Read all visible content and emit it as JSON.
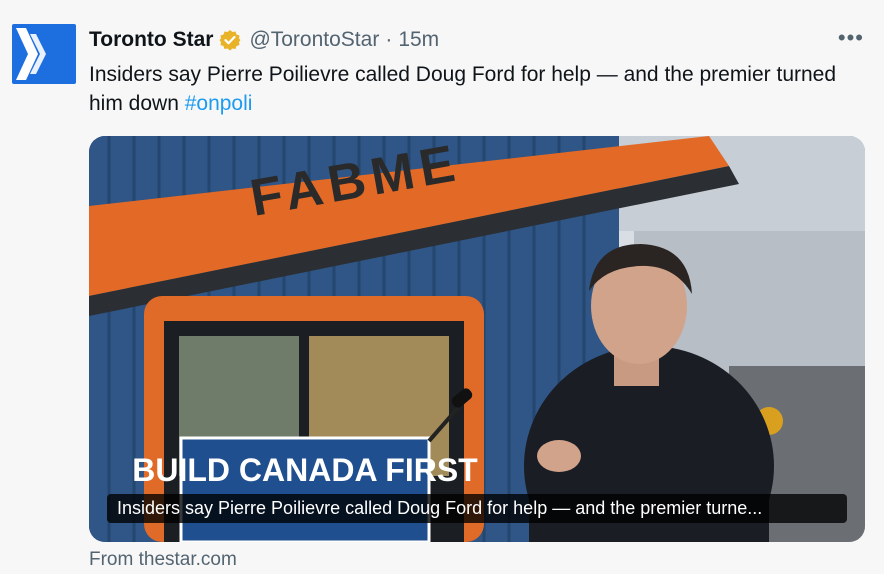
{
  "account": {
    "name": "Toronto Star",
    "handle": "@TorontoStar",
    "separator": "·",
    "time": "15m",
    "verified": true,
    "avatar_icon": "toronto-star-logo-icon",
    "avatar_color": "#1d6fe0"
  },
  "menu": {
    "more_label": "•••"
  },
  "tweet": {
    "text": "Insiders say Pierre Poilievre called Doug Ford for help — and the premier turned him down ",
    "hashtag": "#onpoli"
  },
  "card": {
    "caption": "Insiders say Pierre Poilievre called Doug Ford for help — and the premier turne...",
    "image_text": {
      "crane_brand": "FABME",
      "sign": "BUILD CANADA FIRST"
    }
  },
  "source": {
    "label": "From thestar.com"
  },
  "colors": {
    "accent": "#1d9bf0",
    "verified_gold": "#e8b229",
    "text_primary": "#0f1419",
    "text_secondary": "#536471"
  }
}
